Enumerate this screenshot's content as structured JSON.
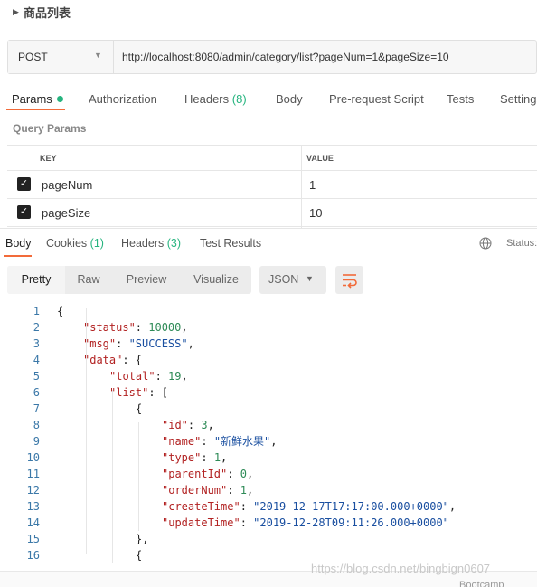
{
  "request": {
    "name": "商品列表",
    "method": "POST",
    "url": "http://localhost:8080/admin/category/list?pageNum=1&pageSize=10"
  },
  "request_tabs": [
    {
      "label": "Params",
      "count": ""
    },
    {
      "label": "Authorization",
      "count": ""
    },
    {
      "label": "Headers",
      "count": "(8)"
    },
    {
      "label": "Body",
      "count": ""
    },
    {
      "label": "Pre-request Script",
      "count": ""
    },
    {
      "label": "Tests",
      "count": ""
    },
    {
      "label": "Settings",
      "count": ""
    }
  ],
  "query_params": {
    "title": "Query Params",
    "col_key": "KEY",
    "col_value": "VALUE",
    "rows": [
      {
        "checked": true,
        "key": "pageNum",
        "value": "1"
      },
      {
        "checked": true,
        "key": "pageSize",
        "value": "10"
      }
    ]
  },
  "response_tabs": [
    {
      "label": "Body",
      "count": ""
    },
    {
      "label": "Cookies",
      "count": "(1)"
    },
    {
      "label": "Headers",
      "count": "(3)"
    },
    {
      "label": "Test Results",
      "count": ""
    }
  ],
  "status_label": "Status:",
  "view_modes": [
    "Pretty",
    "Raw",
    "Preview",
    "Visualize"
  ],
  "format": "JSON",
  "code_lines": [
    {
      "n": "1",
      "indent": 0,
      "parts": [
        [
          "p",
          "{"
        ]
      ]
    },
    {
      "n": "2",
      "indent": 1,
      "parts": [
        [
          "k",
          "\"status\""
        ],
        [
          "p",
          ": "
        ],
        [
          "n",
          "10000"
        ],
        [
          "p",
          ","
        ]
      ]
    },
    {
      "n": "3",
      "indent": 1,
      "parts": [
        [
          "k",
          "\"msg\""
        ],
        [
          "p",
          ": "
        ],
        [
          "s",
          "\"SUCCESS\""
        ],
        [
          "p",
          ","
        ]
      ]
    },
    {
      "n": "4",
      "indent": 1,
      "parts": [
        [
          "k",
          "\"data\""
        ],
        [
          "p",
          ": {"
        ]
      ]
    },
    {
      "n": "5",
      "indent": 2,
      "parts": [
        [
          "k",
          "\"total\""
        ],
        [
          "p",
          ": "
        ],
        [
          "n",
          "19"
        ],
        [
          "p",
          ","
        ]
      ]
    },
    {
      "n": "6",
      "indent": 2,
      "parts": [
        [
          "k",
          "\"list\""
        ],
        [
          "p",
          ": ["
        ]
      ]
    },
    {
      "n": "7",
      "indent": 3,
      "parts": [
        [
          "p",
          "{"
        ]
      ]
    },
    {
      "n": "8",
      "indent": 4,
      "parts": [
        [
          "k",
          "\"id\""
        ],
        [
          "p",
          ": "
        ],
        [
          "n",
          "3"
        ],
        [
          "p",
          ","
        ]
      ]
    },
    {
      "n": "9",
      "indent": 4,
      "parts": [
        [
          "k",
          "\"name\""
        ],
        [
          "p",
          ": "
        ],
        [
          "s",
          "\"新鲜水果\""
        ],
        [
          "p",
          ","
        ]
      ]
    },
    {
      "n": "10",
      "indent": 4,
      "parts": [
        [
          "k",
          "\"type\""
        ],
        [
          "p",
          ": "
        ],
        [
          "n",
          "1"
        ],
        [
          "p",
          ","
        ]
      ]
    },
    {
      "n": "11",
      "indent": 4,
      "parts": [
        [
          "k",
          "\"parentId\""
        ],
        [
          "p",
          ": "
        ],
        [
          "n",
          "0"
        ],
        [
          "p",
          ","
        ]
      ]
    },
    {
      "n": "12",
      "indent": 4,
      "parts": [
        [
          "k",
          "\"orderNum\""
        ],
        [
          "p",
          ": "
        ],
        [
          "n",
          "1"
        ],
        [
          "p",
          ","
        ]
      ]
    },
    {
      "n": "13",
      "indent": 4,
      "parts": [
        [
          "k",
          "\"createTime\""
        ],
        [
          "p",
          ": "
        ],
        [
          "s",
          "\"2019-12-17T17:17:00.000+0000\""
        ],
        [
          "p",
          ","
        ]
      ]
    },
    {
      "n": "14",
      "indent": 4,
      "parts": [
        [
          "k",
          "\"updateTime\""
        ],
        [
          "p",
          ": "
        ],
        [
          "s",
          "\"2019-12-28T09:11:26.000+0000\""
        ]
      ]
    },
    {
      "n": "15",
      "indent": 3,
      "parts": [
        [
          "p",
          "},"
        ]
      ]
    },
    {
      "n": "16",
      "indent": 3,
      "parts": [
        [
          "p",
          "{"
        ]
      ]
    }
  ],
  "footer_app": "Bootcamp",
  "watermark": "https://blog.csdn.net/bingbign0607",
  "colors": {
    "accent": "#f26b3a",
    "green": "#26b47f"
  }
}
